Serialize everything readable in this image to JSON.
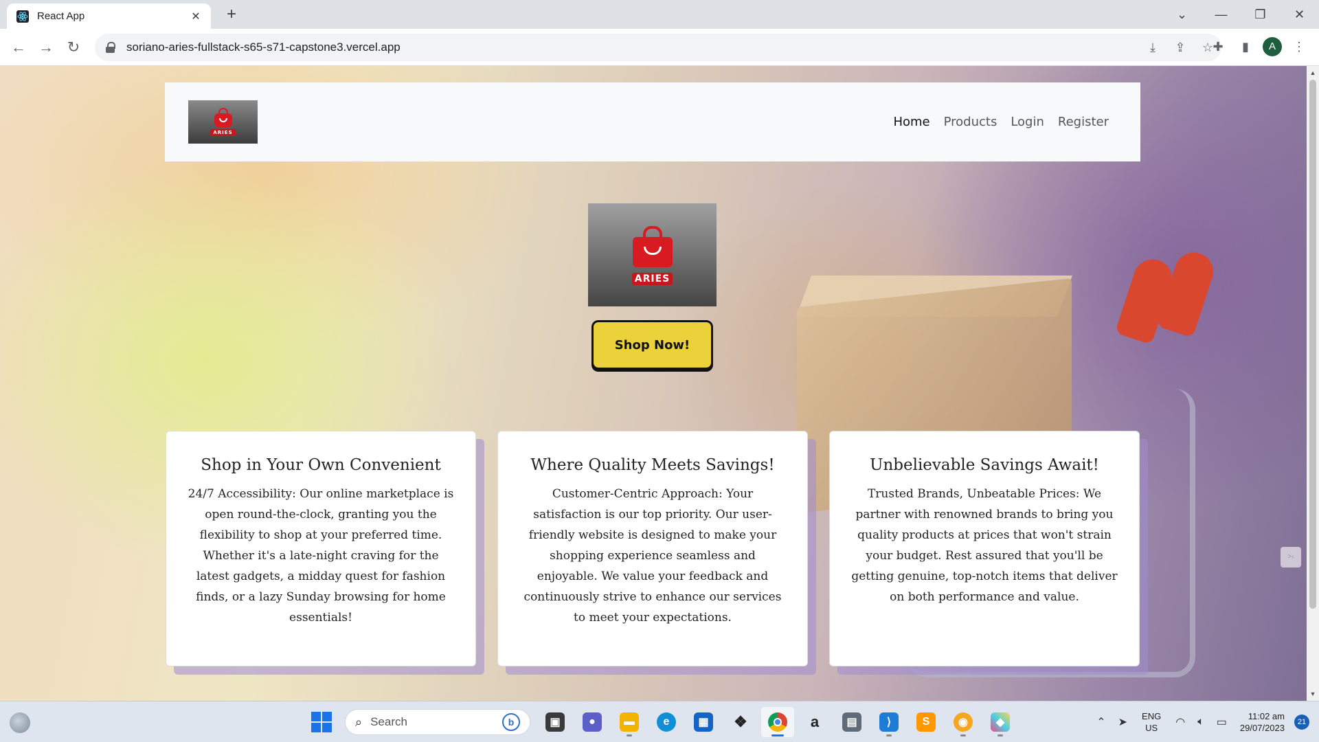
{
  "browser": {
    "tab_title": "React App",
    "url": "soriano-aries-fullstack-s65-s71-capstone3.vercel.app",
    "profile_initial": "A"
  },
  "site": {
    "logo_text": "ARIES",
    "nav": [
      "Home",
      "Products",
      "Login",
      "Register"
    ],
    "cta": "Shop Now!",
    "cards": [
      {
        "title": "Shop in Your Own Convenient",
        "body": "24/7 Accessibility: Our online marketplace is open round-the-clock, granting you the flexibility to shop at your preferred time. Whether it's a late-night craving for the latest gadgets, a midday quest for fashion finds, or a lazy Sunday browsing for home essentials!"
      },
      {
        "title": "Where Quality Meets Savings!",
        "body": "Customer-Centric Approach: Your satisfaction is our top priority. Our user-friendly website is designed to make your shopping experience seamless and enjoyable. We value your feedback and continuously strive to enhance our services to meet your expectations."
      },
      {
        "title": "Unbelievable Savings Await!",
        "body": "Trusted Brands, Unbeatable Prices: We partner with renowned brands to bring you quality products at prices that won't strain your budget. Rest assured that you'll be getting genuine, top-notch items that deliver on both performance and value."
      }
    ]
  },
  "taskbar": {
    "search_placeholder": "Search",
    "lang_line1": "ENG",
    "lang_line2": "US",
    "time": "11:02 am",
    "date": "29/07/2023",
    "notification_count": "21",
    "apps": [
      "file-explorer-icon",
      "video-call-icon",
      "folder-icon",
      "edge-icon",
      "store-icon",
      "dropbox-icon",
      "chrome-icon",
      "amazon-icon",
      "calculator-icon",
      "vscode-icon",
      "sublime-icon",
      "app-icon",
      "app-icon-2"
    ]
  },
  "colors": {
    "accent_yellow": "#ecd23a",
    "logo_red": "#d81b22",
    "chrome_blue": "#1a73e8"
  }
}
